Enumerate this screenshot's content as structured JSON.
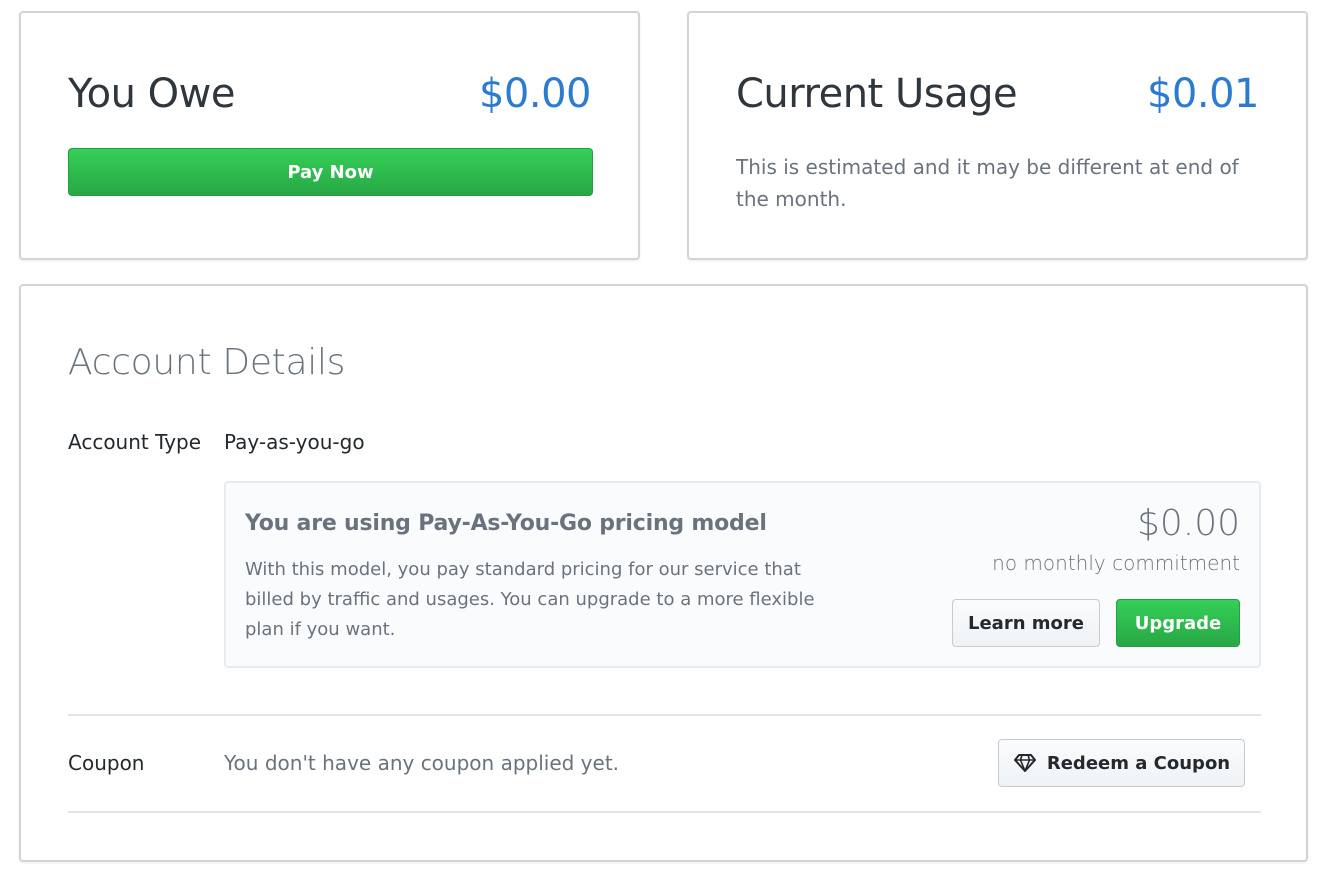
{
  "owe_card": {
    "title": "You Owe",
    "amount": "$0.00",
    "pay_button": "Pay Now"
  },
  "usage_card": {
    "title": "Current Usage",
    "amount": "$0.01",
    "note": "This is estimated and it may be different at end of the month."
  },
  "account": {
    "title": "Account Details",
    "type_label": "Account Type",
    "type_value": "Pay-as-you-go",
    "plan": {
      "heading": "You are using Pay-As-You-Go pricing model",
      "description": "With this model, you pay standard pricing for our service that billed by traffic and usages. You can upgrade to a more flexible plan if you want.",
      "price": "$0.00",
      "commitment": "no monthly commitment",
      "learn_more_button": "Learn more",
      "upgrade_button": "Upgrade"
    },
    "coupon_label": "Coupon",
    "coupon_value": "You don't have any coupon applied yet.",
    "redeem_button": "Redeem a Coupon",
    "redeem_icon": "diamond-icon"
  },
  "colors": {
    "accent_blue": "#2b7bd1",
    "success_green": "#28a745",
    "muted_text": "#6a737d"
  }
}
